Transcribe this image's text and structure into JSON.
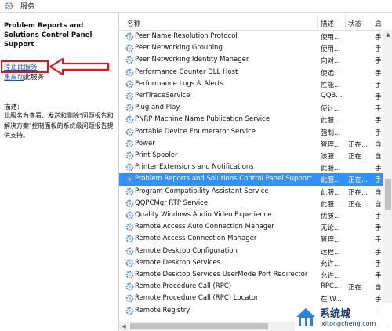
{
  "window": {
    "title": "服务"
  },
  "details": {
    "service_name": "Problem Reports and Solutions Control Panel Support",
    "stop_link": "停止",
    "stop_suffix": "此服务",
    "restart_link": "重启动",
    "restart_suffix": "此服务",
    "description_label": "描述:",
    "description_text": "此服务为查看、发送和删除\"问题报告和解决方案\"控制面板的系统级问题报告提供支持。"
  },
  "columns": {
    "name": "名称",
    "description": "描述",
    "status": "状态",
    "startup": "启"
  },
  "services": [
    {
      "name": "Peer Name Resolution Protocol",
      "description": "使用...",
      "status": "",
      "startup": "手"
    },
    {
      "name": "Peer Networking Grouping",
      "description": "使用...",
      "status": "",
      "startup": "手"
    },
    {
      "name": "Peer Networking Identity Manager",
      "description": "向对...",
      "status": "",
      "startup": "手"
    },
    {
      "name": "Performance Counter DLL Host",
      "description": "使远...",
      "status": "",
      "startup": "手"
    },
    {
      "name": "Performance Logs & Alerts",
      "description": "性能...",
      "status": "",
      "startup": "手"
    },
    {
      "name": "PerfTraceService",
      "description": "QQB...",
      "status": "",
      "startup": "手"
    },
    {
      "name": "Plug and Play",
      "description": "使计...",
      "status": "",
      "startup": "手"
    },
    {
      "name": "PNRP Machine Name Publication Service",
      "description": "此服...",
      "status": "",
      "startup": "手"
    },
    {
      "name": "Portable Device Enumerator Service",
      "description": "强制...",
      "status": "",
      "startup": "手"
    },
    {
      "name": "Power",
      "description": "管理...",
      "status": "正在...",
      "startup": "自"
    },
    {
      "name": "Print Spooler",
      "description": "该服...",
      "status": "正在...",
      "startup": "自"
    },
    {
      "name": "Printer Extensions and Notifications",
      "description": "此服...",
      "status": "",
      "startup": "手"
    },
    {
      "name": "Problem Reports and Solutions Control Panel Support",
      "description": "此服...",
      "status": "正在...",
      "startup": "手"
    },
    {
      "name": "Program Compatibility Assistant Service",
      "description": "此服...",
      "status": "正在...",
      "startup": "自"
    },
    {
      "name": "QQPCMgr RTP Service",
      "description": "此服...",
      "status": "正在...",
      "startup": "自"
    },
    {
      "name": "Quality Windows Audio Video Experience",
      "description": "优质...",
      "status": "",
      "startup": "手"
    },
    {
      "name": "Remote Access Auto Connection Manager",
      "description": "无论...",
      "status": "",
      "startup": "手"
    },
    {
      "name": "Remote Access Connection Manager",
      "description": "管理...",
      "status": "",
      "startup": "手"
    },
    {
      "name": "Remote Desktop Configuration",
      "description": "远程...",
      "status": "",
      "startup": "手"
    },
    {
      "name": "Remote Desktop Services",
      "description": "允许...",
      "status": "",
      "startup": "手"
    },
    {
      "name": "Remote Desktop Services UserMode Port Redirector",
      "description": "允许...",
      "status": "",
      "startup": "手"
    },
    {
      "name": "Remote Procedure Call (RPC)",
      "description": "RPC...",
      "status": "正在...",
      "startup": "自"
    },
    {
      "name": "Remote Procedure Call (RPC) Locator",
      "description": "在 W...",
      "status": "",
      "startup": "手"
    },
    {
      "name": "Remote Registry",
      "description": "使远...",
      "status": "",
      "startup": "禁"
    }
  ],
  "selected_index": 12,
  "icons": {
    "window": "gear-icon",
    "service": "gear-icon",
    "scroll_up": "chevron-up-icon",
    "scroll_down": "chevron-down-icon",
    "scroll_left": "chevron-left-icon",
    "scroll_right": "chevron-right-icon"
  },
  "colors": {
    "selection": "#3390ff",
    "link": "#1a4fc1",
    "annotation": "#e8101b"
  },
  "watermark": {
    "title": "系统城",
    "url": "xitongcheng.com"
  }
}
